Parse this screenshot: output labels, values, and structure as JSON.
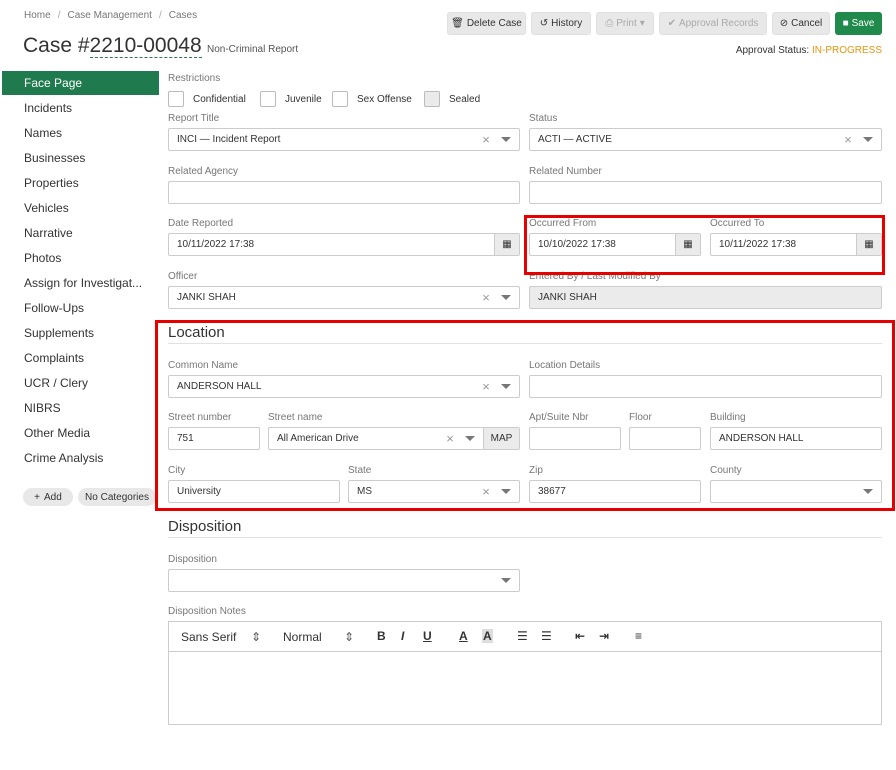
{
  "breadcrumb": [
    "Home",
    "Case Management",
    "Cases"
  ],
  "case": {
    "prefix": "Case #",
    "number": "2210-00048",
    "type": "Non-Criminal Report"
  },
  "actions": {
    "delete": "Delete Case",
    "history": "History",
    "print": "Print",
    "approval_records": "Approval Records",
    "cancel": "Cancel",
    "save": "Save"
  },
  "approval": {
    "label": "Approval Status:",
    "value": "IN-PROGRESS"
  },
  "sidebar": {
    "items": [
      {
        "label": "Face Page",
        "active": true
      },
      {
        "label": "Incidents"
      },
      {
        "label": "Names"
      },
      {
        "label": "Businesses"
      },
      {
        "label": "Properties"
      },
      {
        "label": "Vehicles"
      },
      {
        "label": "Narrative"
      },
      {
        "label": "Photos"
      },
      {
        "label": "Assign for Investigat..."
      },
      {
        "label": "Follow-Ups"
      },
      {
        "label": "Supplements"
      },
      {
        "label": "Complaints"
      },
      {
        "label": "UCR / Clery"
      },
      {
        "label": "NIBRS"
      },
      {
        "label": "Other Media"
      },
      {
        "label": "Crime Analysis"
      }
    ],
    "add_label": "Add",
    "categories_label": "No Categories"
  },
  "restrictions": {
    "label": "Restrictions",
    "options": [
      "Confidential",
      "Juvenile",
      "Sex Offense",
      "Sealed"
    ]
  },
  "form": {
    "report_title": {
      "label": "Report Title",
      "value": "INCI — Incident Report"
    },
    "status": {
      "label": "Status",
      "value": "ACTI — ACTIVE"
    },
    "related_agency": {
      "label": "Related Agency",
      "value": ""
    },
    "related_number": {
      "label": "Related Number",
      "value": ""
    },
    "date_reported": {
      "label": "Date Reported",
      "value": "10/11/2022 17:38"
    },
    "occurred_from": {
      "label": "Occurred From",
      "value": "10/10/2022 17:38"
    },
    "occurred_to": {
      "label": "Occurred To",
      "value": "10/11/2022 17:38"
    },
    "officer": {
      "label": "Officer",
      "value": "JANKI SHAH"
    },
    "entered_by": {
      "label": "Entered By / Last Modified By",
      "value": "JANKI SHAH"
    }
  },
  "location": {
    "title": "Location",
    "common_name": {
      "label": "Common Name",
      "value": "ANDERSON HALL"
    },
    "location_details": {
      "label": "Location Details",
      "value": ""
    },
    "street_number": {
      "label": "Street number",
      "value": "751"
    },
    "street_name": {
      "label": "Street name",
      "value": "All American Drive"
    },
    "map_label": "MAP",
    "apt": {
      "label": "Apt/Suite Nbr",
      "value": ""
    },
    "floor": {
      "label": "Floor",
      "value": ""
    },
    "building": {
      "label": "Building",
      "value": "ANDERSON HALL"
    },
    "city": {
      "label": "City",
      "value": "University"
    },
    "state": {
      "label": "State",
      "value": "MS"
    },
    "zip": {
      "label": "Zip",
      "value": "38677"
    },
    "county": {
      "label": "County",
      "value": ""
    }
  },
  "disposition": {
    "title": "Disposition",
    "field": {
      "label": "Disposition",
      "value": ""
    },
    "notes_label": "Disposition Notes",
    "toolbar": {
      "font": "Sans Serif",
      "size": "Normal"
    }
  },
  "colors": {
    "accent_green": "#1f7a4d",
    "status_orange": "#e8950f",
    "highlight_red": "#e60000"
  }
}
